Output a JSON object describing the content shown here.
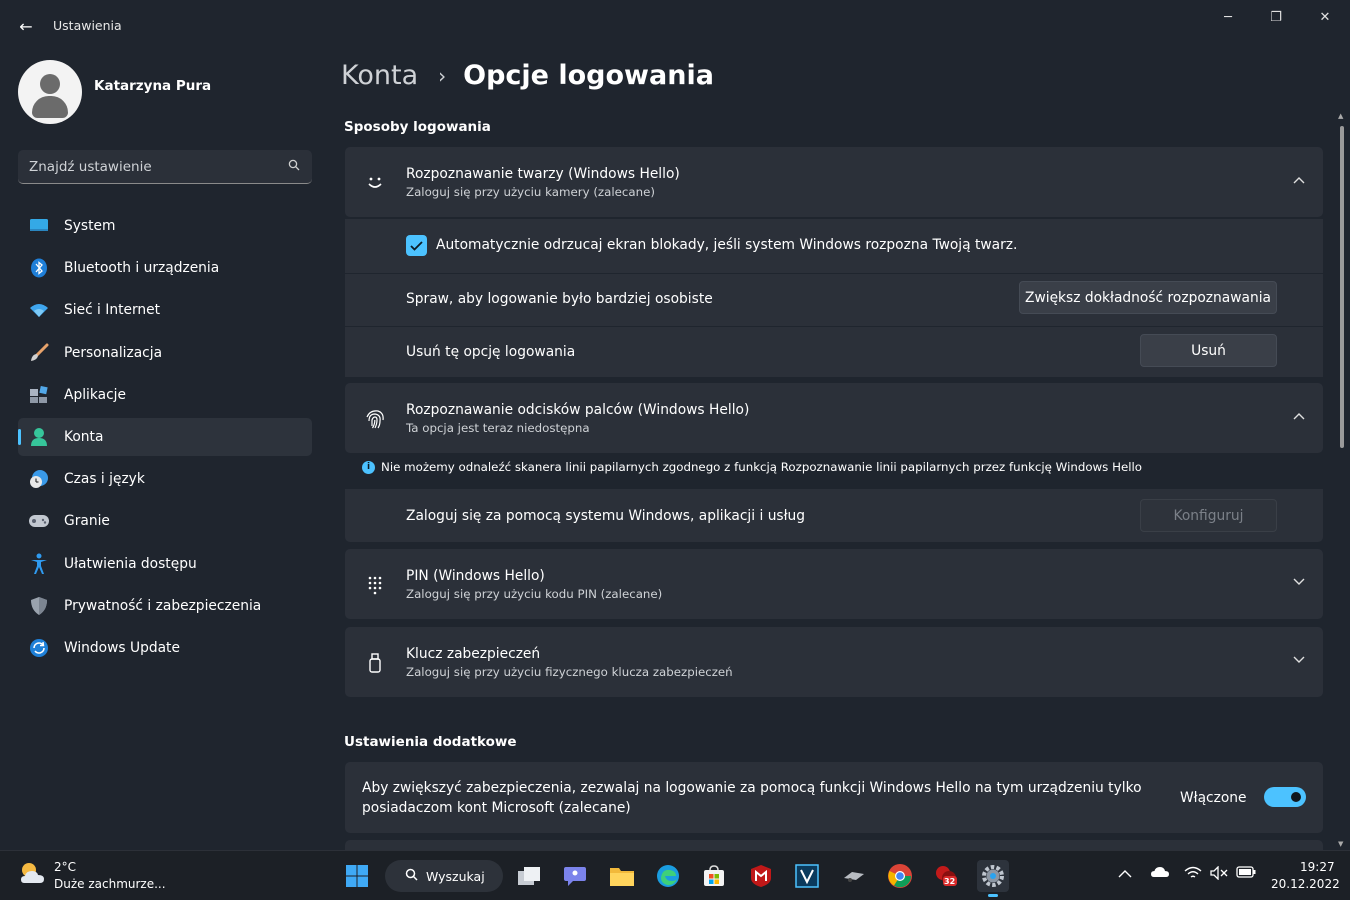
{
  "window": {
    "title": "Ustawienia",
    "back_glyph": "←",
    "minimize_glyph": "─",
    "maximize_glyph": "❐",
    "close_glyph": "✕"
  },
  "user": {
    "name": "Katarzyna Pura"
  },
  "search": {
    "placeholder": "Znajdź ustawienie",
    "icon": "search-icon"
  },
  "sidebar": {
    "items": [
      {
        "label": "System",
        "icon": "monitor-icon",
        "active": false
      },
      {
        "label": "Bluetooth i urządzenia",
        "icon": "bluetooth-icon",
        "active": false
      },
      {
        "label": "Sieć i Internet",
        "icon": "wifi-icon",
        "active": false
      },
      {
        "label": "Personalizacja",
        "icon": "brush-icon",
        "active": false
      },
      {
        "label": "Aplikacje",
        "icon": "apps-icon",
        "active": false
      },
      {
        "label": "Konta",
        "icon": "account-icon",
        "active": true
      },
      {
        "label": "Czas i język",
        "icon": "clock-globe-icon",
        "active": false
      },
      {
        "label": "Granie",
        "icon": "gamepad-icon",
        "active": false
      },
      {
        "label": "Ułatwienia dostępu",
        "icon": "accessibility-icon",
        "active": false
      },
      {
        "label": "Prywatność i zabezpieczenia",
        "icon": "shield-icon",
        "active": false
      },
      {
        "label": "Windows Update",
        "icon": "update-icon",
        "active": false
      }
    ]
  },
  "breadcrumb": {
    "parent": "Konta",
    "separator": "›",
    "current": "Opcje logowania"
  },
  "sections": {
    "ways": "Sposoby logowania",
    "additional": "Ustawienia dodatkowe"
  },
  "face": {
    "title": "Rozpoznawanie twarzy (Windows Hello)",
    "subtitle": "Zaloguj się przy użyciu kamery (zalecane)",
    "auto_dismiss": "Automatycznie odrzucaj ekran blokady, jeśli system Windows rozpozna Twoją twarz.",
    "auto_dismiss_checked": true,
    "personal_label": "Spraw, aby logowanie było bardziej osobiste",
    "improve_button": "Zwiększ dokładność rozpoznawania",
    "remove_label": "Usuń tę opcję logowania",
    "remove_button": "Usuń"
  },
  "fingerprint": {
    "title": "Rozpoznawanie odcisków palców (Windows Hello)",
    "subtitle": "Ta opcja jest teraz niedostępna",
    "info": "Nie możemy odnaleźć skanera linii papilarnych zgodnego z funkcją Rozpoznawanie linii papilarnych przez funkcję Windows Hello",
    "signin_label": "Zaloguj się za pomocą systemu Windows, aplikacji i usług",
    "configure_button": "Konfiguruj"
  },
  "pin": {
    "title": "PIN (Windows Hello)",
    "subtitle": "Zaloguj się przy użyciu kodu PIN (zalecane)"
  },
  "key": {
    "title": "Klucz zabezpieczeń",
    "subtitle": "Zaloguj się przy użyciu fizycznego klucza zabezpieczeń"
  },
  "additional": {
    "text_line1": "Aby zwiększyć zabezpieczenia, zezwalaj na logowanie za pomocą funkcji Windows Hello na tym urządzeniu tylko",
    "text_line2": "posiadaczom kont Microsoft (zalecane)",
    "toggle_label": "Włączone",
    "toggle_on": true
  },
  "taskbar": {
    "weather_temp": "2°C",
    "weather_desc": "Duże zachmurze...",
    "search_label": "Wyszukaj",
    "time": "19:27",
    "date": "20.12.2022",
    "badge_count": "32"
  },
  "colors": {
    "accent": "#4cc2ff",
    "card": "#2b3039",
    "background": "#1f252e"
  }
}
